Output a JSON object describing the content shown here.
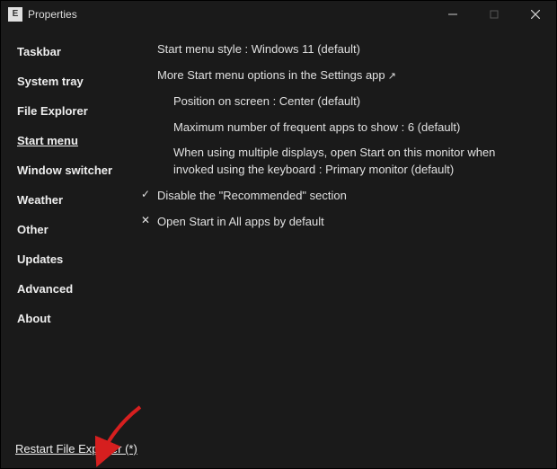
{
  "titlebar": {
    "title": "Properties",
    "app_icon_letter": "E"
  },
  "sidebar": {
    "items": [
      {
        "label": "Taskbar",
        "active": false
      },
      {
        "label": "System tray",
        "active": false
      },
      {
        "label": "File Explorer",
        "active": false
      },
      {
        "label": "Start menu",
        "active": true
      },
      {
        "label": "Window switcher",
        "active": false
      },
      {
        "label": "Weather",
        "active": false
      },
      {
        "label": "Other",
        "active": false
      },
      {
        "label": "Updates",
        "active": false
      },
      {
        "label": "Advanced",
        "active": false
      },
      {
        "label": "About",
        "active": false
      }
    ]
  },
  "main": {
    "style_line": "Start menu style : Windows 11 (default)",
    "more_options_link": "More Start menu options in the Settings app",
    "sub": {
      "position": "Position on screen : Center (default)",
      "max_frequent": "Maximum number of frequent apps to show : 6 (default)",
      "multi_display": "When using multiple displays, open Start on this monitor when invoked using the keyboard : Primary monitor (default)"
    },
    "check_disable_recommended": "Disable the \"Recommended\" section",
    "uncheck_open_all_apps": "Open Start in All apps by default"
  },
  "footer": {
    "restart_link": "Restart File Explorer (*)"
  },
  "icons": {
    "check": "✓",
    "cross": "✕"
  }
}
